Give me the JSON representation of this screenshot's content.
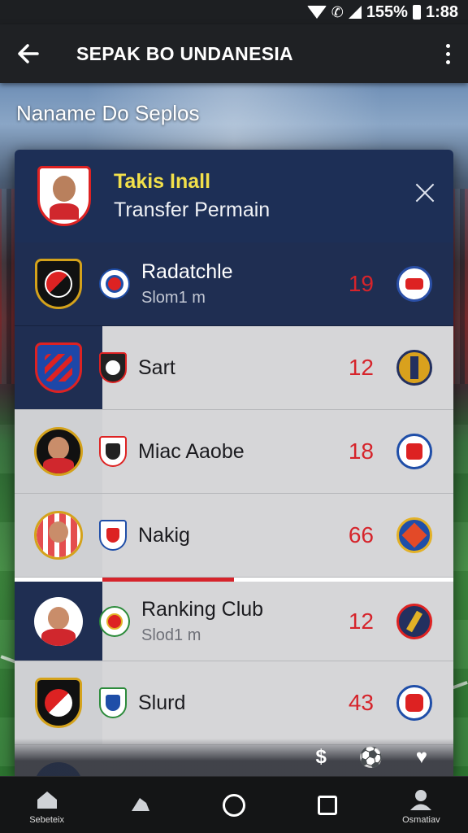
{
  "status_bar": {
    "battery": "155%",
    "time": "1:88"
  },
  "app_bar": {
    "title": "SEPAK BO UNDANESIA"
  },
  "section_title": "Naname Do Seplos",
  "panel": {
    "title": "Takis Inall",
    "subtitle": "Transfer Permain"
  },
  "rows": [
    {
      "name": "Radatchle",
      "sub": "Slom1 m",
      "num": "19"
    },
    {
      "name": "Sart",
      "sub": "",
      "num": "12"
    },
    {
      "name": "Miac Aaobe",
      "sub": "",
      "num": "18"
    },
    {
      "name": "Nakig",
      "sub": "",
      "num": "66"
    },
    {
      "name": "Ranking Club",
      "sub": "Slod1 m",
      "num": "12"
    },
    {
      "name": "Slurd",
      "sub": "",
      "num": "43"
    }
  ],
  "nav": {
    "left_label": "Sebeteix",
    "right_label": "Osmatiav"
  },
  "colors": {
    "accent_red": "#d6242b",
    "navy": "#1f2e52",
    "header_title": "#f2e04a"
  }
}
